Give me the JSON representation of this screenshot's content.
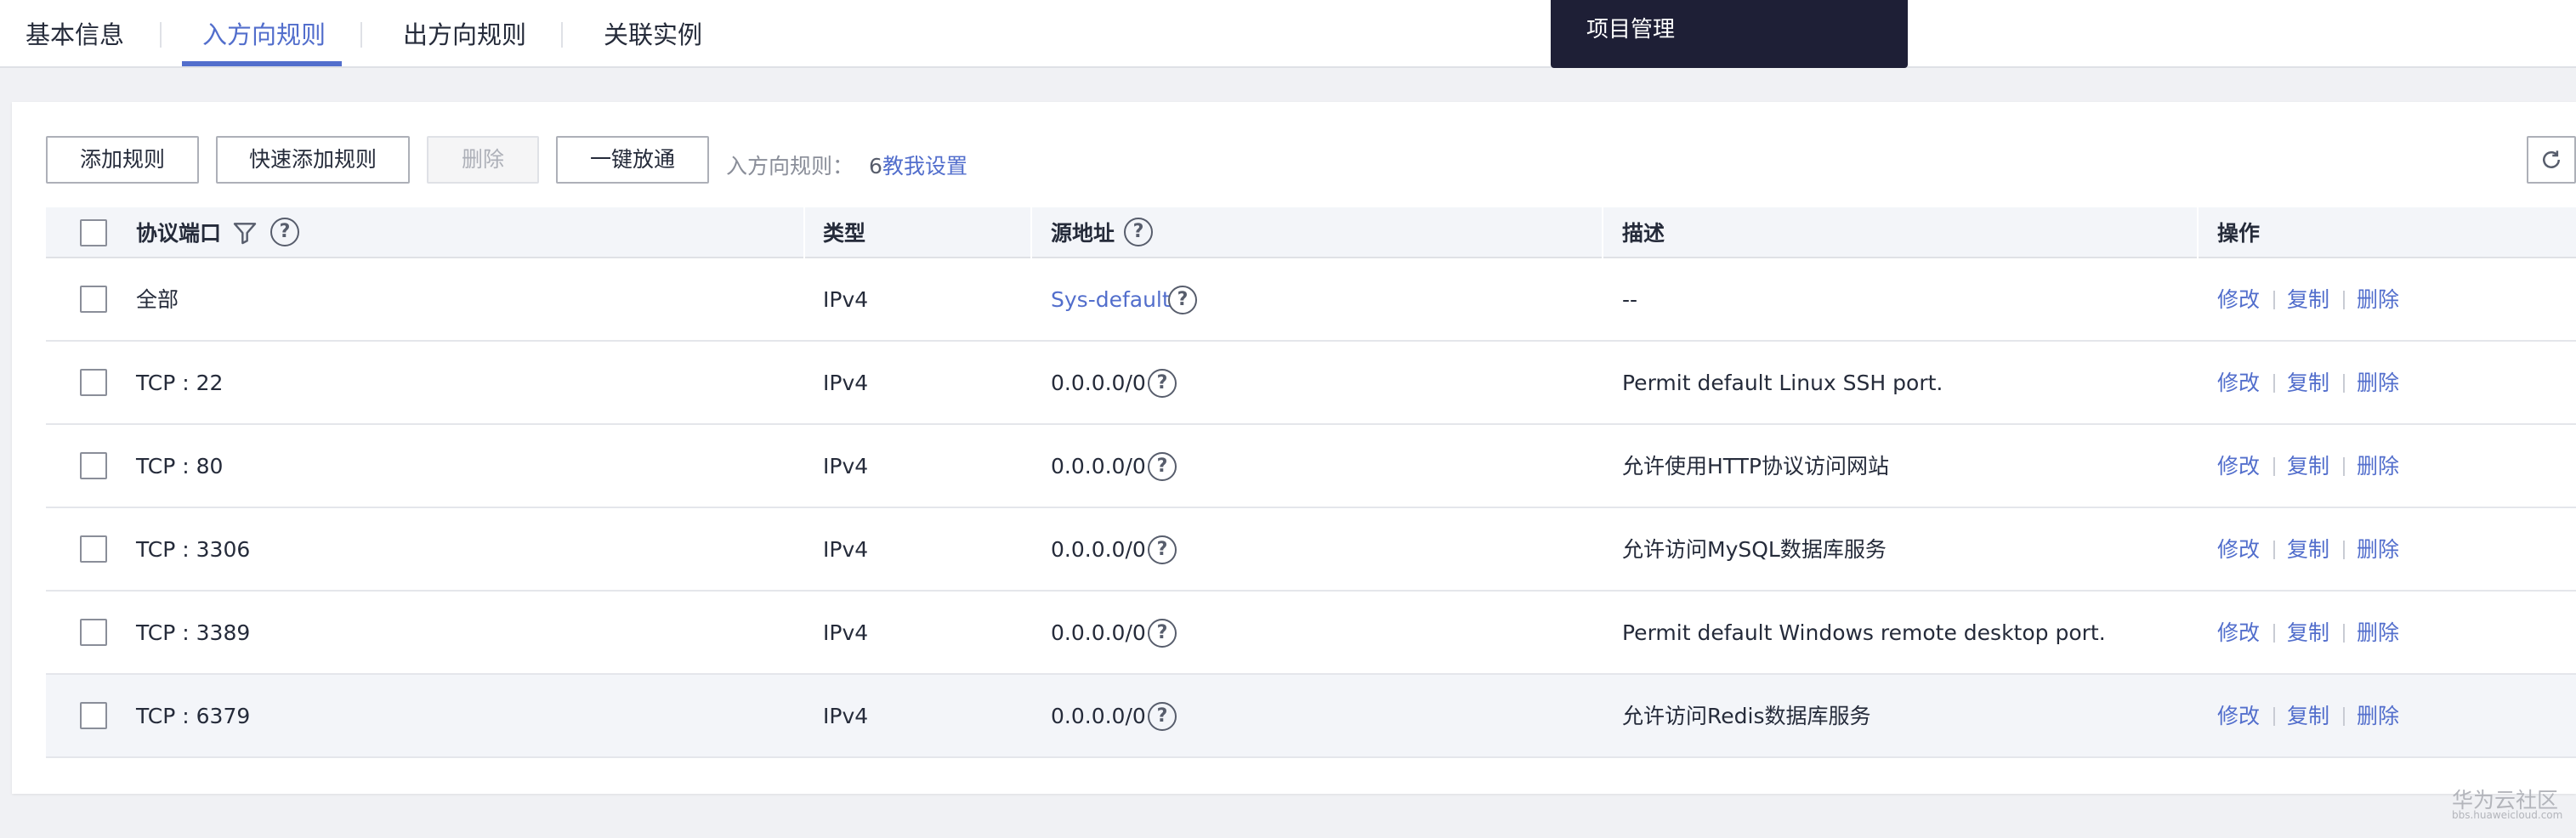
{
  "tabs": [
    {
      "label": "基本信息",
      "active": false
    },
    {
      "label": "入方向规则",
      "active": true
    },
    {
      "label": "出方向规则",
      "active": false
    },
    {
      "label": "关联实例",
      "active": false
    }
  ],
  "dropdown": {
    "item": "项目管理"
  },
  "toolbar": {
    "add_rule": "添加规则",
    "quick_add_rule": "快速添加规则",
    "delete": "删除",
    "one_click_allow": "一键放通",
    "rule_count_label": "入方向规则：",
    "rule_count": "6",
    "guide_link": "教我设置"
  },
  "table": {
    "headers": {
      "protocol_port": "协议端口",
      "type": "类型",
      "source": "源地址",
      "description": "描述",
      "actions": "操作"
    },
    "action_labels": {
      "modify": "修改",
      "copy": "复制",
      "delete": "删除"
    },
    "rows": [
      {
        "port": "全部",
        "type": "IPv4",
        "source": "Sys-default",
        "source_is_link": true,
        "description": "--"
      },
      {
        "port": "TCP : 22",
        "type": "IPv4",
        "source": "0.0.0.0/0",
        "source_is_link": false,
        "description": "Permit default Linux SSH port."
      },
      {
        "port": "TCP : 80",
        "type": "IPv4",
        "source": "0.0.0.0/0",
        "source_is_link": false,
        "description": "允许使用HTTP协议访问网站"
      },
      {
        "port": "TCP : 3306",
        "type": "IPv4",
        "source": "0.0.0.0/0",
        "source_is_link": false,
        "description": "允许访问MySQL数据库服务"
      },
      {
        "port": "TCP : 3389",
        "type": "IPv4",
        "source": "0.0.0.0/0",
        "source_is_link": false,
        "description": "Permit default Windows remote desktop port."
      },
      {
        "port": "TCP : 6379",
        "type": "IPv4",
        "source": "0.0.0.0/0",
        "source_is_link": false,
        "description": "允许访问Redis数据库服务"
      }
    ]
  },
  "watermark": {
    "main": "华为云社区",
    "sub": "bbs.huaweicloud.com"
  },
  "colors": {
    "accent": "#526ecc",
    "text": "#252b3a",
    "header_bg": "#f3f5f9",
    "dropdown_bg": "#1e1f36"
  }
}
